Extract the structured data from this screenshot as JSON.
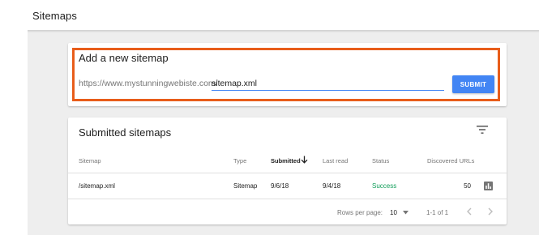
{
  "page": {
    "title": "Sitemaps"
  },
  "add_sitemap": {
    "title": "Add a new sitemap",
    "url_prefix": "https://www.mystunningwebiste.com/",
    "input_value": "sitemap.xml",
    "submit_label": "SUBMIT"
  },
  "submitted": {
    "title": "Submitted sitemaps",
    "columns": [
      "Sitemap",
      "Type",
      "Submitted",
      "Last read",
      "Status",
      "Discovered URLs"
    ],
    "rows": [
      {
        "sitemap": "/sitemap.xml",
        "type": "Sitemap",
        "submitted": "9/6/18",
        "last_read": "9/4/18",
        "status": "Success",
        "discovered_urls": "50"
      }
    ],
    "footer": {
      "rows_per_page_label": "Rows per page:",
      "rows_per_page_value": "10",
      "range": "1-1 of 1"
    }
  },
  "colors": {
    "accent": "#4285f4",
    "highlight_border": "#e85d1a",
    "success": "#0f9d58"
  },
  "icons": [
    "filter-icon",
    "sort-down-arrow-icon",
    "bar-chart-icon",
    "chevron-down-icon",
    "chevron-left-icon",
    "chevron-right-icon"
  ]
}
